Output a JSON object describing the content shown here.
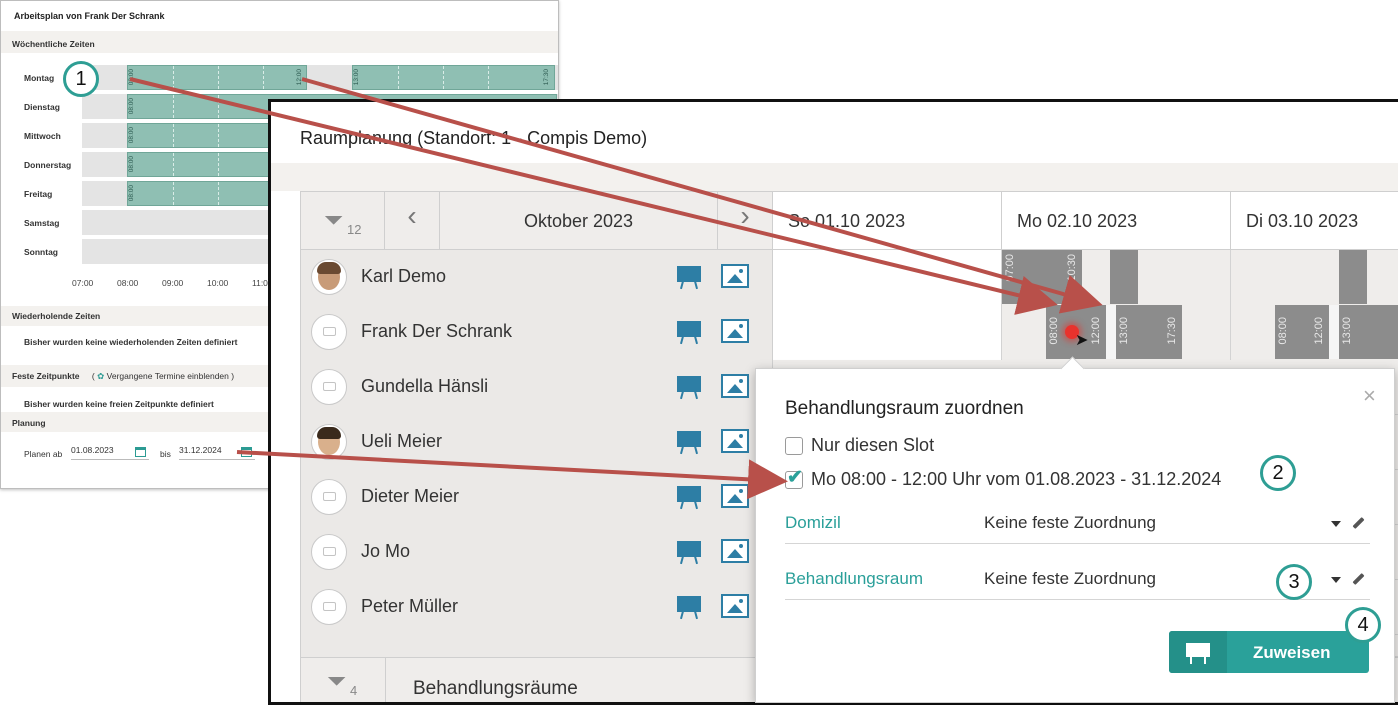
{
  "arbeitsplan": {
    "title": "Arbeitsplan von Frank Der Schrank",
    "weekly_section": "Wöchentliche Zeiten",
    "days": [
      "Montag",
      "Dienstag",
      "Mittwoch",
      "Donnerstag",
      "Freitag",
      "Samstag",
      "Sonntag"
    ],
    "slot_labels": {
      "start": "08:00",
      "mid": "12:00",
      "afternoon_start": "13:00",
      "afternoon_end": "17:30"
    },
    "hours": [
      "07:00",
      "08:00",
      "09:00",
      "10:00",
      "11:0"
    ],
    "recurring_section": "Wiederholende Zeiten",
    "recurring_empty": "Bisher wurden keine wiederholenden Zeiten definiert",
    "fixed_section": "Feste Zeitpunkte",
    "fixed_toggle": "Vergangene Termine einblenden )",
    "fixed_toggle_open": "(",
    "fixed_empty": "Bisher wurden keine freien Zeitpunkte definiert",
    "planning_section": "Planung",
    "plan_from_label": "Planen ab",
    "plan_from_value": "01.08.2023",
    "plan_to_label": "bis",
    "plan_to_value": "31.12.2024"
  },
  "raumplanung": {
    "title": "Raumplanung (Standort: 1 - Compis Demo)",
    "filter_count": "12",
    "month": "Oktober 2023",
    "prev": "‹",
    "next": "›",
    "day_headers": [
      "So 01.10 2023",
      "Mo 02.10 2023",
      "Di 03.10 2023"
    ],
    "people": [
      {
        "name": "Karl Demo",
        "photo": true
      },
      {
        "name": "Frank Der Schrank",
        "photo": false
      },
      {
        "name": "Gundella Hänsli",
        "photo": false
      },
      {
        "name": "Ueli  Meier",
        "photo": true
      },
      {
        "name": "Dieter Meier",
        "photo": false
      },
      {
        "name": "Jo Mo",
        "photo": false
      },
      {
        "name": "Peter Müller",
        "photo": false
      }
    ],
    "bar_labels": {
      "karl_start": "07:00",
      "karl_end": "10:30",
      "frank_start": "08:00",
      "frank_mid": "12:00",
      "frank_pm_start": "13:00",
      "frank_pm_end": "17:30",
      "di_start": "08:00",
      "di_mid": "12:00",
      "di_pm": "13:00"
    },
    "rooms_filter_count": "4",
    "rooms_label": "Behandlungsräume"
  },
  "popup": {
    "title": "Behandlungsraum zuordnen",
    "close": "×",
    "option_slot": "Nur diesen Slot",
    "option_series": "Mo 08:00 - 12:00 Uhr vom 01.08.2023 - 31.12.2024",
    "option_series_checked": true,
    "domizil_label": "Domizil",
    "domizil_value": "Keine feste Zuordnung",
    "room_label": "Behandlungsraum",
    "room_value": "Keine feste Zuordnung",
    "assign_button": "Zuweisen"
  },
  "annotations": [
    "1",
    "2",
    "3",
    "4"
  ],
  "colors": {
    "accent": "#2aa19a",
    "slot_fill": "#8fbfb3",
    "busy_bar": "#8c8c8c",
    "arrow": "#b8504a",
    "icon_blue": "#2d7ea5"
  }
}
